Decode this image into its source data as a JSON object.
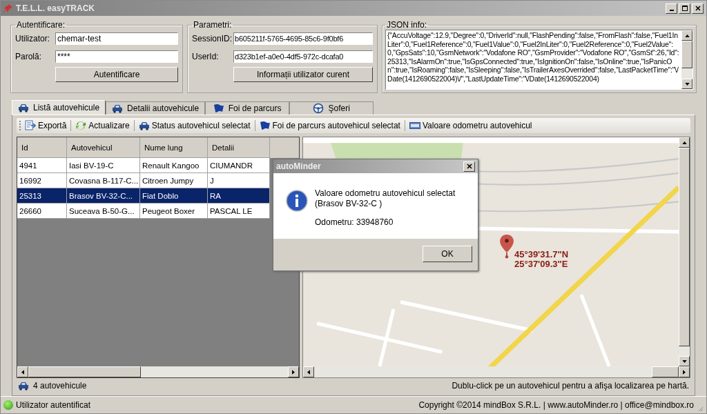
{
  "window": {
    "title": "T.E.L.L. easyTRACK"
  },
  "auth": {
    "legend": "Autentificare:",
    "user_label": "Utilizator:",
    "user_value": "chemar-test",
    "pass_label": "Parolă:",
    "pass_value": "****",
    "button": "Autentificare"
  },
  "params": {
    "legend": "Parametri:",
    "session_label": "SessionID:",
    "session_value": "b605211f-5765-4695-85c6-9f0bf6",
    "user_label": "UserId:",
    "user_value": "d323b1ef-a0e0-4df5-972c-dcafa0",
    "button": "Informații utilizator curent"
  },
  "json_info": {
    "legend": "JSON info:",
    "text": "{\"AccuVoltage\":12.9,\"Degree\":0,\"DriverId\":null,\"FlashPending\":false,\"FromFlash\":false,\"Fuel1InLiter\":0,\"Fuel1Reference\":0,\"Fuel1Value\":0,\"Fuel2InLiter\":0,\"Fuel2Reference\":0,\"Fuel2Value\":0,\"GpsSats\":10,\"GsmNetwork\":\"Vodafone RO\",\"GsmProvider\":\"Vodafone RO\",\"GsmSt\":26,\"Id\":25313,\"IsAlarmOn\":true,\"IsGpsConnected\":true,\"IsIgnitionOn\":false,\"IsOnline\":true,\"IsPanicOn\":true,\"IsRoaming\":false,\"IsSleeping\":false,\"IsTrailerAxesOverrided\":false,\"LastPacketTime\":\"\\/Date(1412690522004)\\/\",\"LastUpdateTime\":\"\\/Date(1412690522004)"
  },
  "tabs": [
    {
      "label": "Listă autovehicule",
      "kind": "car",
      "selected": true
    },
    {
      "label": "Detalii autovehicule",
      "kind": "car",
      "selected": false
    },
    {
      "label": "Foi de parcurs",
      "kind": "flag",
      "selected": false
    },
    {
      "label": "Şoferi",
      "kind": "wheel",
      "selected": false
    }
  ],
  "toolbar": [
    {
      "label": "Exportă",
      "kind": "export"
    },
    {
      "label": "Actualizare",
      "kind": "refresh"
    },
    {
      "label": "Status autovehicul selectat",
      "kind": "car"
    },
    {
      "label": "Foi de parcurs autovehicul selectat",
      "kind": "flag"
    },
    {
      "label": "Valoare odometru autovehicul",
      "kind": "odometer"
    }
  ],
  "table": {
    "columns": [
      "Id",
      "Autovehicul",
      "Nume lung",
      "Detalii"
    ],
    "rows": [
      {
        "cells": [
          "4941",
          "Iasi BV-19-C",
          "Renault Kangoo",
          "CIUMANDR"
        ],
        "selected": false
      },
      {
        "cells": [
          "16992",
          "Covasna B-117-C...",
          "Citroen Jumpy",
          "J"
        ],
        "selected": false
      },
      {
        "cells": [
          "25313",
          "Brasov BV-32-C...",
          "Fiat Doblo",
          "RA"
        ],
        "selected": true
      },
      {
        "cells": [
          "26660",
          "Suceava B-50-G...",
          "Peugeot Boxer",
          "PASCAL LE"
        ],
        "selected": false
      }
    ]
  },
  "map": {
    "marker_lines": [
      "45°39'31.7\"N",
      "25°37'09.3\"E"
    ]
  },
  "footer": {
    "count": "4 autovehicule",
    "hint": "Dublu-click pe un autovehicul pentru a afişa localizarea pe hartă."
  },
  "status_bar": {
    "status": "Utilizator autentificat",
    "copyright": "Copyright ©2014 mindBox S.R.L.  | www.autoMinder.ro  | office@mindbox.ro"
  },
  "dialog": {
    "title": "autoMinder",
    "message_lines": [
      "Valoare odometru autovehicul selectat",
      "(Brasov BV-32-C )"
    ],
    "detail": "Odometru: 33948760",
    "button": "OK"
  }
}
